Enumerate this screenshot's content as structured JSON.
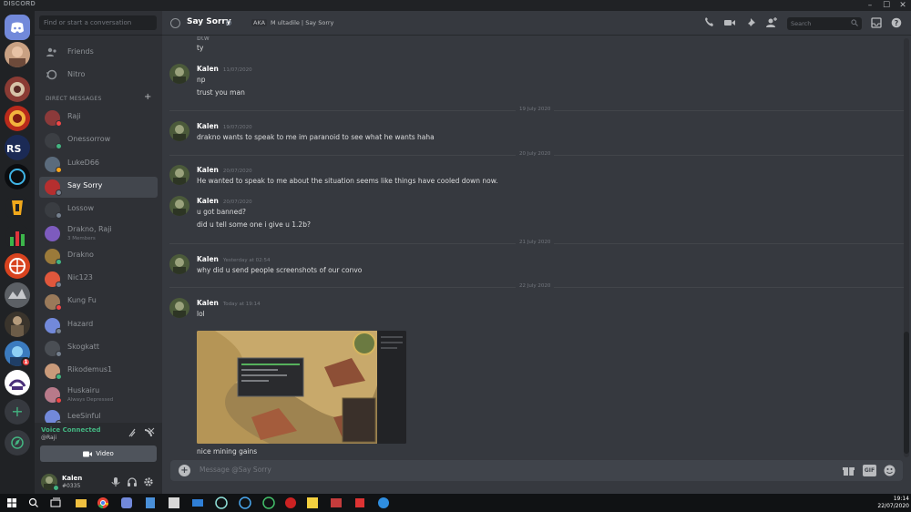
{
  "titlebar": {
    "brand": "DISCORD",
    "minimize": "–",
    "maximize": "☐",
    "close": "✕"
  },
  "sidebar": {
    "search_placeholder": "Find or start a conversation",
    "nav": [
      {
        "label": "Friends"
      },
      {
        "label": "Nitro"
      }
    ],
    "dm_header": "DIRECT MESSAGES",
    "dm_add": "+",
    "dms": [
      {
        "name": "Raji",
        "status": "dnd"
      },
      {
        "name": "Onessorrow",
        "status": "online"
      },
      {
        "name": "LukeD66",
        "status": "idle"
      },
      {
        "name": "Say Sorry",
        "status": "offline",
        "active": true
      },
      {
        "name": "Lossow",
        "status": "offline"
      },
      {
        "name": "Drakno, Raji",
        "sub": "3 Members"
      },
      {
        "name": "Drakno",
        "status": "online"
      },
      {
        "name": "Nic123",
        "status": "offline"
      },
      {
        "name": "Kung Fu",
        "status": "dnd"
      },
      {
        "name": "Hazard",
        "status": "offline"
      },
      {
        "name": "Skogkatt",
        "status": "offline"
      },
      {
        "name": "Rikodemus1",
        "status": "online"
      },
      {
        "name": "Huskairu",
        "sub": "Always Depressed",
        "status": "dnd"
      },
      {
        "name": "LeeSinful",
        "status": "offline"
      }
    ],
    "voice": {
      "status": "Voice Connected",
      "channel": "@Raji",
      "video_label": "Video"
    },
    "user": {
      "name": "Kalen",
      "tag": "#0335"
    }
  },
  "rail": {
    "ping_count": "1",
    "add": "+"
  },
  "header": {
    "channel": "Say Sorry",
    "aka_label": "AKA",
    "aka_value": "M ultadile | Say Sorry",
    "search_placeholder": "Search"
  },
  "messages": {
    "top_fragment_1": "btw",
    "top_fragment_2": "ty",
    "groups": [
      {
        "author": "Kalen",
        "time": "11/07/2020",
        "lines": [
          "np",
          "trust you man"
        ]
      },
      {
        "author": "Kalen",
        "time": "19/07/2020",
        "lines": [
          "drakno wants to speak to me im paranoid to see what he wants haha"
        ]
      },
      {
        "author": "Kalen",
        "time": "20/07/2020",
        "lines": [
          "He wanted to speak to me about the situation seems like things have cooled down now."
        ]
      },
      {
        "author": "Kalen",
        "time": "20/07/2020",
        "lines": [
          "u got banned?",
          "did u tell some one i give u 1.2b?"
        ]
      },
      {
        "author": "Kalen",
        "time": "Yesterday at 02:54",
        "lines": [
          "why did u send people screenshots of our convo"
        ]
      },
      {
        "author": "Kalen",
        "time": "Today at 19:14",
        "lines": [
          "lol",
          "nice mining gains"
        ]
      }
    ],
    "dividers": [
      "19 July 2020",
      "20 July 2020",
      "21 July 2020",
      "22 July 2020"
    ]
  },
  "composer": {
    "placeholder": "Message @Say Sorry",
    "gif_label": "GIF"
  },
  "taskbar": {
    "time": "19:14",
    "date": "22/07/2020"
  },
  "colors": {
    "blurple": "#7289da",
    "online": "#43b581",
    "idle": "#faa61a",
    "dnd": "#f04747",
    "offline": "#747f8d"
  }
}
